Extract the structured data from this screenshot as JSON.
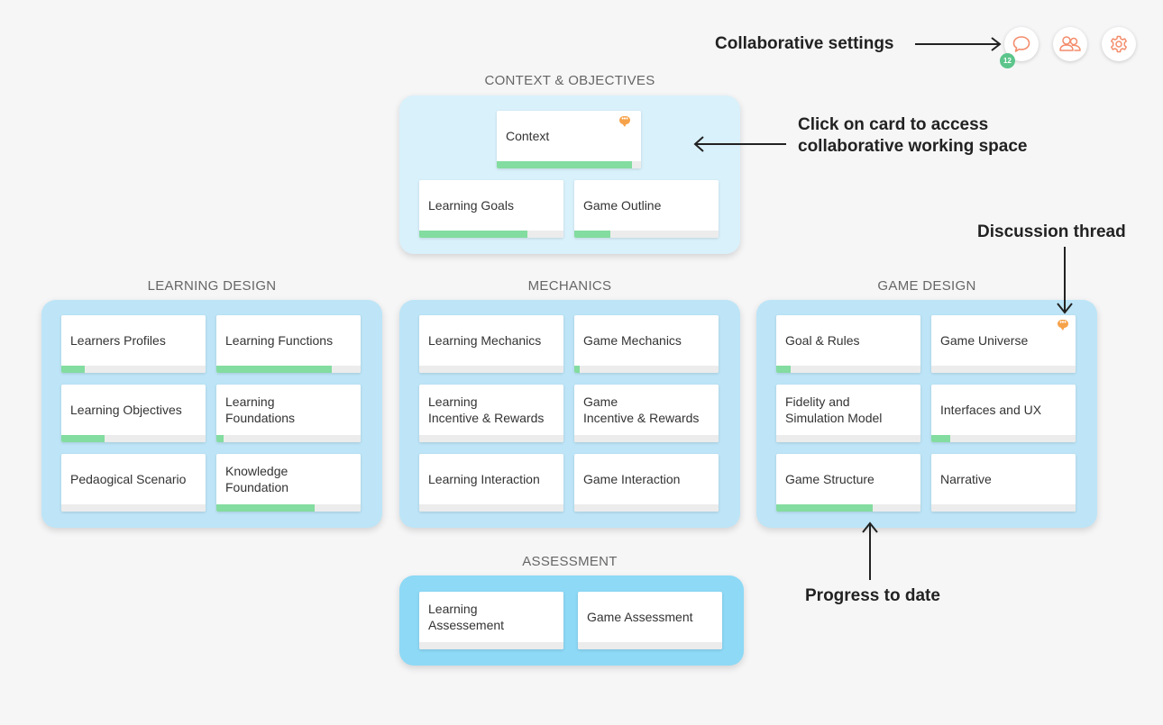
{
  "colors": {
    "progress": "#83dca0",
    "accent": "#f6a24a",
    "badge": "#5cc58b"
  },
  "annotations": {
    "collaborative_settings": "Collaborative settings",
    "click_on_card": "Click on card to access\ncollaborative working space",
    "discussion_thread": "Discussion thread",
    "progress_to_date": "Progress to date"
  },
  "toolbar": {
    "chat": {
      "icon": "chat-bubble-icon",
      "badge": "12"
    },
    "users": {
      "icon": "users-icon"
    },
    "settings": {
      "icon": "gear-icon"
    }
  },
  "groups": {
    "context": {
      "title": "CONTEXT & OBJECTIVES",
      "cards": [
        {
          "label": "Context",
          "progress": 0.94,
          "comments": true
        },
        {
          "label": "Learning Goals",
          "progress": 0.75
        },
        {
          "label": "Game Outline",
          "progress": 0.25
        }
      ]
    },
    "learning": {
      "title": "LEARNING DESIGN",
      "cards": [
        {
          "label": "Learners Profiles",
          "progress": 0.16
        },
        {
          "label": "Learning Functions",
          "progress": 0.8
        },
        {
          "label": "Learning Objectives",
          "progress": 0.3
        },
        {
          "label": "Learning\nFoundations",
          "progress": 0.05
        },
        {
          "label": "Pedaogical Scenario",
          "progress": 0.0
        },
        {
          "label": "Knowledge\nFoundation",
          "progress": 0.68
        }
      ]
    },
    "mechanics": {
      "title": "MECHANICS",
      "cards": [
        {
          "label": "Learning Mechanics",
          "progress": 0.0
        },
        {
          "label": "Game Mechanics",
          "progress": 0.04
        },
        {
          "label": "Learning\nIncentive & Rewards",
          "progress": 0.0
        },
        {
          "label": "Game\nIncentive & Rewards",
          "progress": 0.0
        },
        {
          "label": "Learning Interaction",
          "progress": 0.0
        },
        {
          "label": "Game Interaction",
          "progress": 0.0
        }
      ]
    },
    "game": {
      "title": "GAME DESIGN",
      "cards": [
        {
          "label": "Goal & Rules",
          "progress": 0.1
        },
        {
          "label": "Game Universe",
          "progress": 0.0,
          "comments": true
        },
        {
          "label": "Fidelity and\nSimulation Model",
          "progress": 0.0
        },
        {
          "label": "Interfaces and UX",
          "progress": 0.13
        },
        {
          "label": "Game Structure",
          "progress": 0.67
        },
        {
          "label": "Narrative",
          "progress": 0.0
        }
      ]
    },
    "assessment": {
      "title": "ASSESSMENT",
      "cards": [
        {
          "label": "Learning\nAssessement",
          "progress": 0.0
        },
        {
          "label": "Game Assessment",
          "progress": 0.0
        }
      ]
    }
  }
}
